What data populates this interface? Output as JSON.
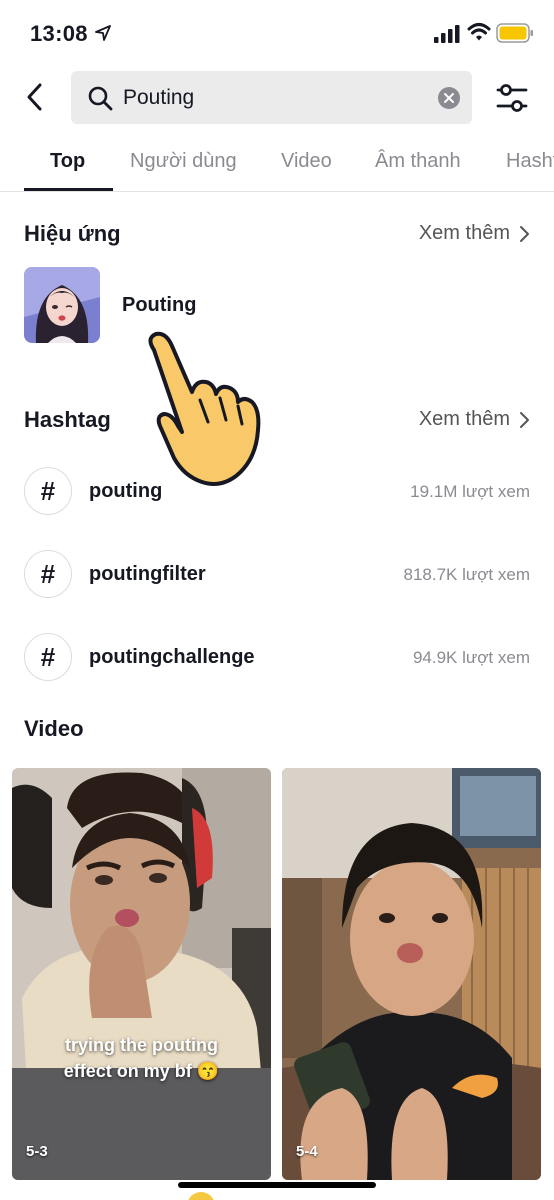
{
  "status_bar": {
    "time": "13:08",
    "icons": [
      "location-arrow-icon",
      "signal-bars-icon",
      "wifi-icon",
      "battery-icon"
    ],
    "battery_color": "#f7c600"
  },
  "search": {
    "query": "Pouting",
    "icons": [
      "back-arrow-icon",
      "search-icon",
      "clear-icon",
      "filter-sliders-icon"
    ]
  },
  "tabs": [
    {
      "label": "Top",
      "active": true
    },
    {
      "label": "Người dùng",
      "active": false
    },
    {
      "label": "Video",
      "active": false
    },
    {
      "label": "Âm thanh",
      "active": false
    },
    {
      "label": "Hashtag",
      "active": false
    }
  ],
  "effects_section": {
    "title": "Hiệu ứng",
    "see_more": "Xem thêm",
    "items": [
      {
        "name": "Pouting"
      }
    ]
  },
  "hashtag_section": {
    "title": "Hashtag",
    "see_more": "Xem thêm",
    "items": [
      {
        "symbol": "#",
        "name": "pouting",
        "views": "19.1M lượt xem"
      },
      {
        "symbol": "#",
        "name": "poutingfilter",
        "views": "818.7K lượt xem"
      },
      {
        "symbol": "#",
        "name": "poutingchallenge",
        "views": "94.9K lượt xem"
      }
    ]
  },
  "video_section": {
    "title": "Video",
    "items": [
      {
        "caption_line1": "trying the pouting",
        "caption_line2": "effect on my bf 😙",
        "date": "5-3"
      },
      {
        "caption_line1": "",
        "caption_line2": "",
        "date": "5-4"
      }
    ]
  },
  "overlay": {
    "icon": "hand-pointer-icon",
    "color": "#f9c969"
  }
}
